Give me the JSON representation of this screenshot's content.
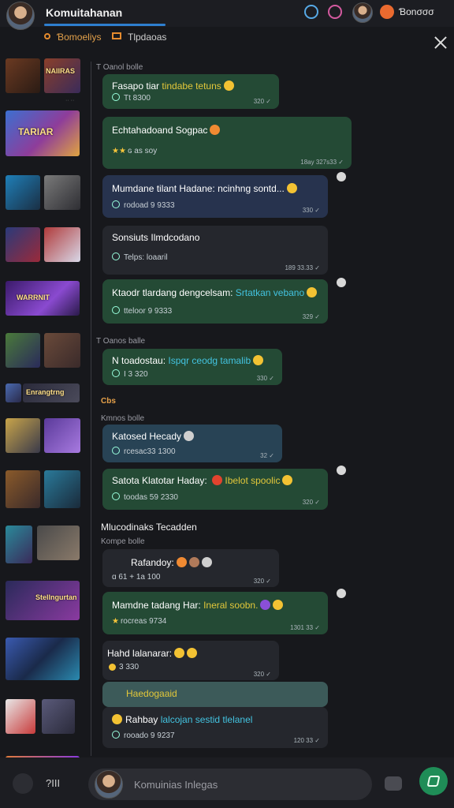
{
  "header": {
    "title": "Komuitahanan",
    "right_label": "Ɓonσσσ",
    "tabs": [
      "Ɓomoeliys",
      "Tlpdaoas"
    ]
  },
  "composer": {
    "placeholder": "Komuinias Inlegas",
    "left_label": "?III"
  },
  "sections": {
    "s1": "T Oanol bolle",
    "s2": "T Oanos balle",
    "s3": "Cbs",
    "s4": "Kmnos bolle",
    "s5": "Mlucodinaks Tecadden",
    "s6": "Kompe bolle"
  },
  "messages": [
    {
      "title_a": "Fasapo tiar ",
      "title_hl": "tindabe tetuns",
      "sub": "Tt 8300",
      "time": "320 ✓"
    },
    {
      "title_a": "Echtahadoand Sogpac",
      "sub": "ɢ as soy",
      "time": "18ay 327s33 ✓"
    },
    {
      "title_a": "Mumdane tilant Hadane: ",
      "title_b": "ncinhng sontd...",
      "sub": "rodoad 9 9333",
      "time": "330 ✓"
    },
    {
      "title_a": "Sonsiuts Ilmdcodano",
      "sub": "Telps: loaaril",
      "time": "189 33.33 ✓"
    },
    {
      "title_a": "Ktaodr tlardang dengcelsam: ",
      "title_b": "Srtatkan vebano",
      "sub": "tteloor 9 9333",
      "time": "329 ✓"
    },
    {
      "title_a": "N toadostau: ",
      "title_b": "Ispqr ceodg tamalib",
      "sub": "I 3 320",
      "time": "330 ✓"
    },
    {
      "title_a": "Katosed Hecady",
      "sub": "rcesac33 1300",
      "time": "32 ✓"
    },
    {
      "title_a": "Satota Klatotar Haday: ",
      "title_b": "Ibelot spoolic",
      "sub": "toodas 59 2330",
      "time": "320 ✓"
    },
    {
      "title_a": "Rafandoy:",
      "sub": "ɑ 61 + 1a 100",
      "time": "320 ✓"
    },
    {
      "title_a": "Mamdne tadang Har: ",
      "title_b": "Ineral soobn.",
      "sub": "rocreas 9734",
      "time": "1301 33 ✓"
    },
    {
      "title_a": "Hahd lalanarar:",
      "sub": "3 330",
      "time": "320 ✓"
    },
    {
      "title_a": "Haedogaaid",
      "sub": "Rahbay ",
      "sub_b": "lalcojan sestid tlelanel",
      "time": ""
    },
    {
      "title_a": "",
      "sub": "rooado 9 9237",
      "time": "120 33 ✓"
    }
  ],
  "thumbs": [
    {
      "caption": "NAIIRAS"
    },
    {
      "caption": "TARIAR"
    },
    {
      "caption": ""
    },
    {
      "caption": ""
    },
    {
      "caption": "WARRNIT"
    },
    {
      "caption": ""
    },
    {
      "caption": "Enrangtrng"
    },
    {
      "caption": ""
    },
    {
      "caption": ""
    },
    {
      "caption": ""
    },
    {
      "caption": "Stellngurtan"
    },
    {
      "caption": ""
    },
    {
      "caption": ""
    }
  ],
  "colors": {
    "accent": "#2e7fd0",
    "green_bubble": "#244a35",
    "send": "#1f8d57"
  }
}
